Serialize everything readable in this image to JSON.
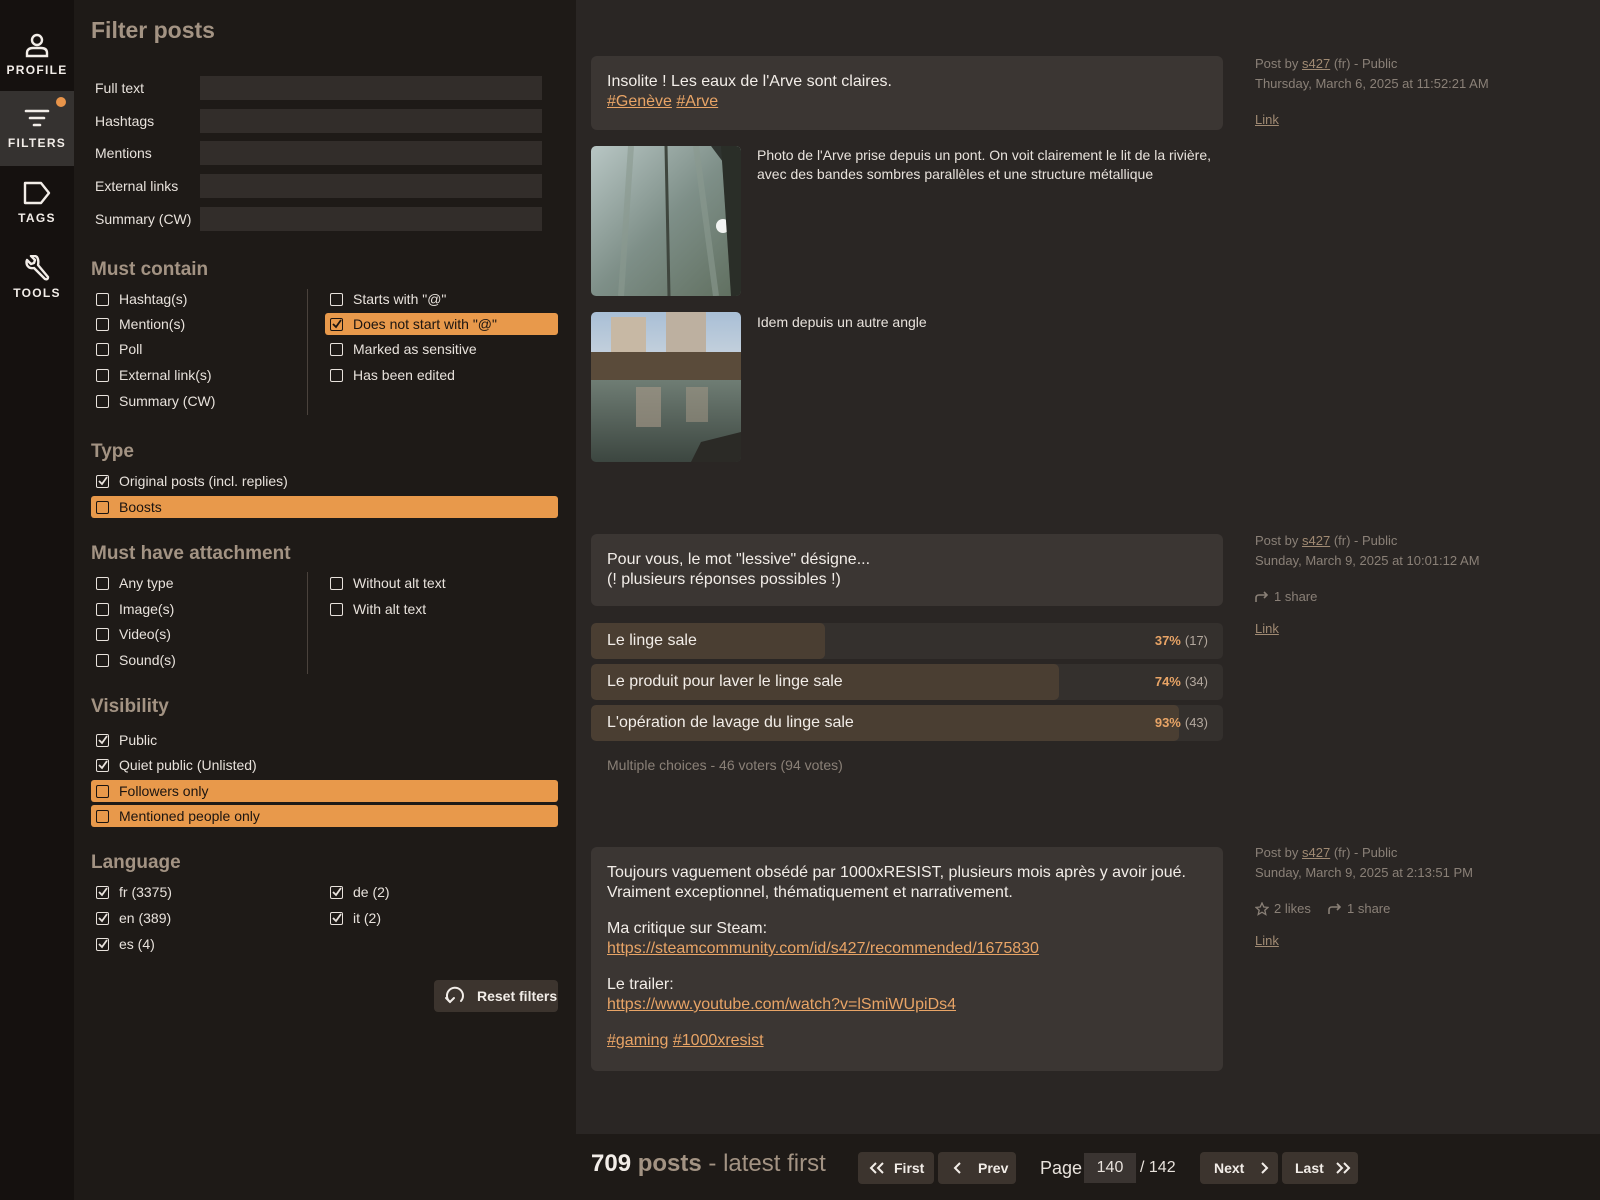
{
  "sidebar": {
    "items": [
      {
        "label": "PROFILE",
        "icon": "profile-icon"
      },
      {
        "label": "FILTERS",
        "icon": "filter-icon",
        "active": true
      },
      {
        "label": "TAGS",
        "icon": "tag-icon"
      },
      {
        "label": "TOOLS",
        "icon": "wrench-icon"
      }
    ]
  },
  "filters": {
    "title": "Filter posts",
    "fields": {
      "full_text": "Full text",
      "hashtags": "Hashtags",
      "mentions": "Mentions",
      "external_links": "External links",
      "summary": "Summary (CW)"
    },
    "must_contain": {
      "title": "Must contain",
      "left": [
        "Hashtag(s)",
        "Mention(s)",
        "Poll",
        "External link(s)",
        "Summary (CW)"
      ],
      "right": [
        "Starts with \"@\"",
        "Does not start with \"@\"",
        "Marked as sensitive",
        "Has been edited"
      ]
    },
    "type": {
      "title": "Type",
      "items": [
        "Original posts (incl. replies)",
        "Boosts"
      ]
    },
    "attachment": {
      "title": "Must have attachment",
      "left": [
        "Any type",
        "Image(s)",
        "Video(s)",
        "Sound(s)"
      ],
      "right": [
        "Without alt text",
        "With alt text"
      ]
    },
    "visibility": {
      "title": "Visibility",
      "items": [
        "Public",
        "Quiet public (Unlisted)",
        "Followers only",
        "Mentioned people only"
      ]
    },
    "language": {
      "title": "Language",
      "left": [
        "fr (3375)",
        "en (389)",
        "es (4)"
      ],
      "right": [
        "de (2)",
        "it (2)"
      ]
    },
    "reset_label": "Reset filters"
  },
  "posts": [
    {
      "line1": "Insolite ! Les eaux de l'Arve sont claires.",
      "tags": [
        "#Genève",
        "#Arve"
      ],
      "meta": {
        "prefix": "Post by",
        "author": "s427",
        "lang": "(fr)",
        "sep": "-",
        "visibility": "Public",
        "date": "Thursday, March 6, 2025 at 11:52:21 AM",
        "link": "Link"
      },
      "media": [
        {
          "desc": "Photo de l'Arve prise depuis un pont. On voit clairement le lit de la rivière, avec des bandes sombres parallèles et une structure métallique"
        },
        {
          "desc": "Idem depuis un autre angle"
        }
      ]
    },
    {
      "line1": "Pour vous, le mot \"lessive\" désigne...",
      "line2": "(! plusieurs réponses possibles !)",
      "meta": {
        "prefix": "Post by",
        "author": "s427",
        "lang": "(fr)",
        "sep": "-",
        "visibility": "Public",
        "date": "Sunday, March 9, 2025 at 10:01:12 AM",
        "shares": "1 share",
        "link": "Link"
      },
      "poll": {
        "options": [
          {
            "label": "Le linge sale",
            "pct": "37%",
            "count": "(17)",
            "fraction": 0.37
          },
          {
            "label": "Le produit pour laver le linge sale",
            "pct": "74%",
            "count": "(34)",
            "fraction": 0.74
          },
          {
            "label": "L'opération de lavage du linge sale",
            "pct": "93%",
            "count": "(43)",
            "fraction": 0.93
          }
        ],
        "note": "Multiple choices - 46 voters (94 votes)"
      }
    },
    {
      "line1": "Toujours vaguement obsédé par 1000xRESIST, plusieurs mois après y avoir joué.",
      "line2": "Vraiment exceptionnel, thématiquement et narrativement.",
      "steam_label": "Ma critique sur Steam:",
      "steam_url": "https://steamcommunity.com/id/s427/recommended/1675830",
      "trailer_label": "Le trailer:",
      "trailer_url": "https://www.youtube.com/watch?v=lSmiWUpiDs4",
      "tags": [
        "#gaming",
        "#1000xresist"
      ],
      "meta": {
        "prefix": "Post by",
        "author": "s427",
        "lang": "(fr)",
        "sep": "-",
        "visibility": "Public",
        "date": "Sunday, March 9, 2025 at 2:13:51 PM",
        "likes": "2 likes",
        "shares": "1 share",
        "link": "Link"
      }
    }
  ],
  "footer": {
    "count": "709",
    "count_word": "posts",
    "sort": "- latest first",
    "first": "First",
    "prev": "Prev",
    "page_label": "Page",
    "page_value": "140",
    "page_total": "/ 142",
    "next": "Next",
    "last": "Last"
  },
  "colors": {
    "accent": "#e8994b",
    "link": "#e8a466",
    "heading": "#a39383"
  }
}
